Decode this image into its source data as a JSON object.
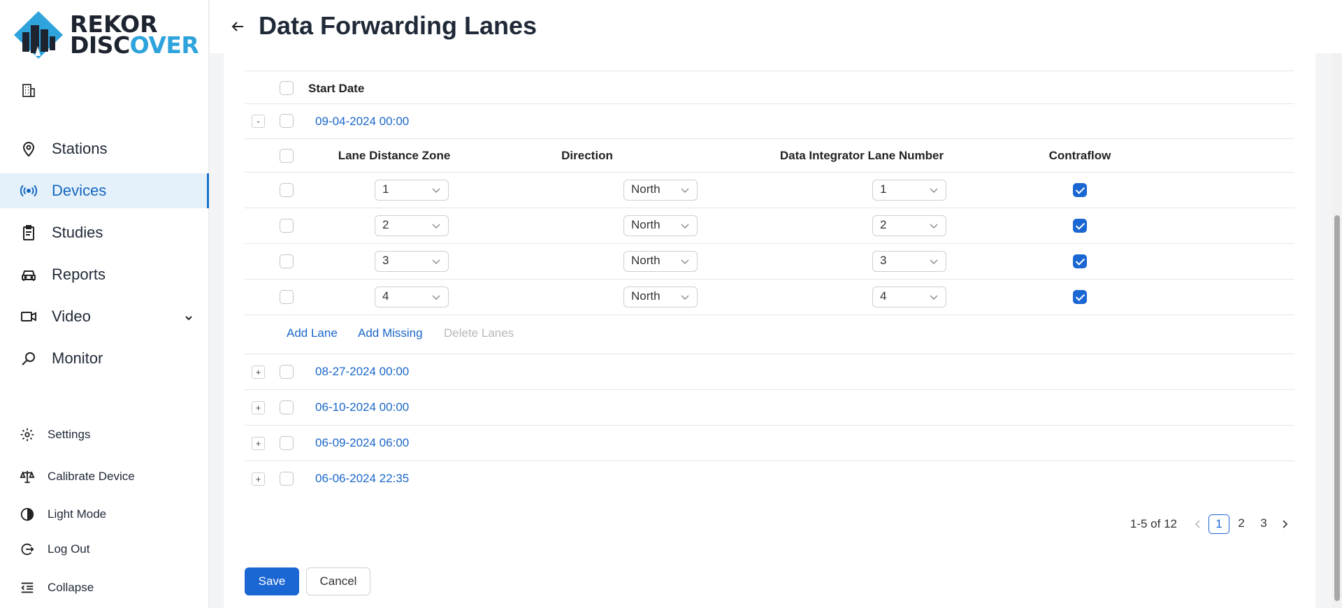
{
  "brand": {
    "line1": "REKOR",
    "line2_a": "DISC",
    "line2_b": "O",
    "line2_c": "VER",
    "accent": "#2ea3dc",
    "dark": "#1d2430"
  },
  "header": {
    "title": "Data Forwarding Lanes",
    "back_icon": "arrow-left-icon"
  },
  "sidebar": {
    "org_icon": "building-icon",
    "items": [
      {
        "label": "Stations",
        "icon": "map-pin-icon",
        "active": false
      },
      {
        "label": "Devices",
        "icon": "broadcast-icon",
        "active": true
      },
      {
        "label": "Studies",
        "icon": "clipboard-icon",
        "active": false
      },
      {
        "label": "Reports",
        "icon": "car-icon",
        "active": false
      },
      {
        "label": "Video",
        "icon": "video-camera-icon",
        "active": false,
        "has_dropdown": true
      },
      {
        "label": "Monitor",
        "icon": "monitor-search-icon",
        "active": false
      }
    ],
    "bottom": [
      {
        "label": "Settings",
        "icon": "gear-icon"
      },
      {
        "label": "Calibrate Device",
        "icon": "scale-icon"
      },
      {
        "label": "Light Mode",
        "icon": "contrast-icon"
      },
      {
        "label": "Log Out",
        "icon": "logout-icon"
      },
      {
        "label": "Collapse",
        "icon": "collapse-icon"
      }
    ]
  },
  "table": {
    "header": {
      "start_date": "Start Date"
    },
    "rows": [
      {
        "date": "09-04-2024 00:00",
        "expanded": true,
        "toggle": "-"
      },
      {
        "date": "08-27-2024 00:00",
        "expanded": false,
        "toggle": "+"
      },
      {
        "date": "06-10-2024 00:00",
        "expanded": false,
        "toggle": "+"
      },
      {
        "date": "06-09-2024 06:00",
        "expanded": false,
        "toggle": "+"
      },
      {
        "date": "06-06-2024 22:35",
        "expanded": false,
        "toggle": "+"
      }
    ],
    "lanes": {
      "columns": [
        "Lane Distance Zone",
        "Direction",
        "Data Integrator Lane Number",
        "Contraflow"
      ],
      "rows": [
        {
          "zone": "1",
          "direction": "North",
          "integrator": "1",
          "contraflow": true
        },
        {
          "zone": "2",
          "direction": "North",
          "integrator": "2",
          "contraflow": true
        },
        {
          "zone": "3",
          "direction": "North",
          "integrator": "3",
          "contraflow": true
        },
        {
          "zone": "4",
          "direction": "North",
          "integrator": "4",
          "contraflow": true
        }
      ],
      "actions": {
        "add_lane": "Add Lane",
        "add_missing": "Add Missing",
        "delete_lanes": "Delete Lanes"
      }
    }
  },
  "pagination": {
    "summary": "1-5 of 12",
    "pages": [
      "1",
      "2",
      "3"
    ],
    "current": "1"
  },
  "buttons": {
    "save": "Save",
    "cancel": "Cancel"
  },
  "colors": {
    "primary": "#1a66d2",
    "active_bg": "#e4f1fb",
    "link": "#1a66c8"
  }
}
